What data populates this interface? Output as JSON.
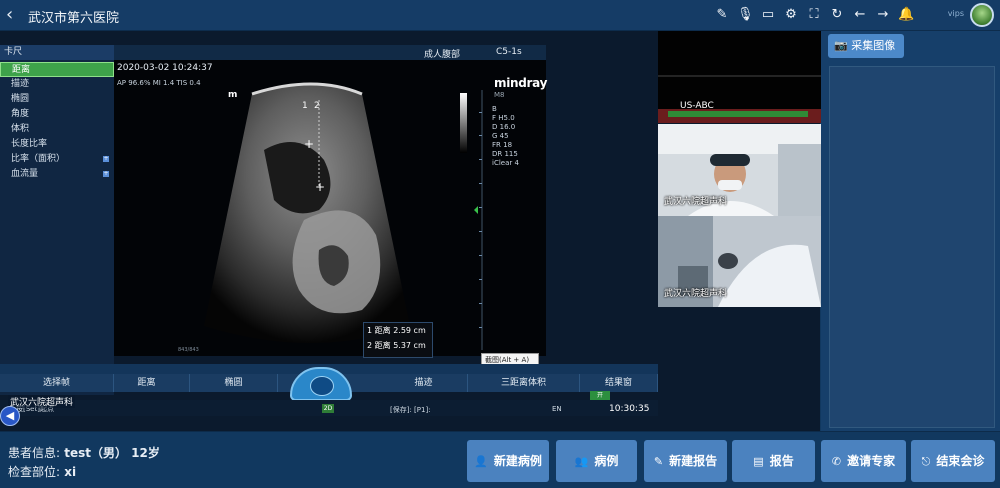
{
  "header": {
    "back_icon": "back-arrow-icon",
    "title": "武汉市第六医院",
    "user_label": "vips",
    "toolbar_icons": [
      "pen-icon",
      "microphone-icon",
      "monitor-icon",
      "gear-icon",
      "fullscreen-icon",
      "refresh-icon",
      "arrow-left-icon",
      "arrow-right-icon",
      "bell-icon"
    ]
  },
  "ultrasound": {
    "menu_title": "卡尺",
    "menu": [
      {
        "label": "距离",
        "active": true,
        "has_submenu": false
      },
      {
        "label": "描迹",
        "active": false,
        "has_submenu": false
      },
      {
        "label": "椭圆",
        "active": false,
        "has_submenu": false
      },
      {
        "label": "角度",
        "active": false,
        "has_submenu": false
      },
      {
        "label": "体积",
        "active": false,
        "has_submenu": false
      },
      {
        "label": "长度比率",
        "active": false,
        "has_submenu": false
      },
      {
        "label": "比率（面积）",
        "active": false,
        "has_submenu": true
      },
      {
        "label": "血流量",
        "active": false,
        "has_submenu": true
      }
    ],
    "preset": "成人腹部",
    "probe": "C5-1s",
    "datetime": "2020-03-02 10:24:37",
    "params": "AP 96.6%  MI 1.4  TIS 0.4",
    "m_marker": "m",
    "brand": "mindray",
    "brand_sub": "M8",
    "right_params": [
      "B",
      "F H5.0",
      "D 16.0",
      "G 45",
      "FR 18",
      "DR 115",
      "iClear 4"
    ],
    "measurements": [
      {
        "index": "1",
        "name": "距离",
        "value": "2.59 cm"
      },
      {
        "index": "2",
        "name": "距离",
        "value": "5.37 cm"
      }
    ],
    "caliper_labels": [
      "1",
      "2"
    ],
    "frame_counter": "843/843",
    "tooltip": "截图(Alt + A)",
    "tabs": [
      "选择帧",
      "距离",
      "椭圆",
      "描迹",
      "三距离体积",
      "结果窗"
    ],
    "result_switch": "开",
    "department": "武汉六院超声科",
    "hint": "按[Set]起点",
    "mode": "2D",
    "save_info": "[保存]: [P1]:",
    "lang": "EN",
    "time": "10:30:35",
    "speaker_icon": "speaker-icon"
  },
  "video": {
    "pane1_label": "US-ABC",
    "pane2_label": "武汉六院超声科",
    "pane3_label": "武汉六院超声科"
  },
  "right_panel": {
    "capture_icon": "camera-icon",
    "capture_label": "采集图像"
  },
  "patient": {
    "info_label": "患者信息:",
    "info_value": "test（男） 12岁",
    "body_label": "检查部位:",
    "body_value": "xi"
  },
  "buttons": [
    {
      "name": "new-case-button",
      "icon": "user-plus-icon",
      "glyph": "👤",
      "label": "新建病例"
    },
    {
      "name": "cases-button",
      "icon": "users-icon",
      "glyph": "👥",
      "label": "病例"
    },
    {
      "name": "new-report-button",
      "icon": "edit-icon",
      "glyph": "✎",
      "label": "新建报告"
    },
    {
      "name": "report-button",
      "icon": "document-icon",
      "glyph": "▤",
      "label": "报告"
    },
    {
      "name": "invite-expert-button",
      "icon": "phone-icon",
      "glyph": "✆",
      "label": "邀请专家"
    },
    {
      "name": "end-meeting-button",
      "icon": "exit-icon",
      "glyph": "⎋",
      "label": "结束会诊"
    }
  ],
  "colors": {
    "background": "#11385f",
    "button": "#4b82bf",
    "active_menu": "#3ea24a"
  }
}
